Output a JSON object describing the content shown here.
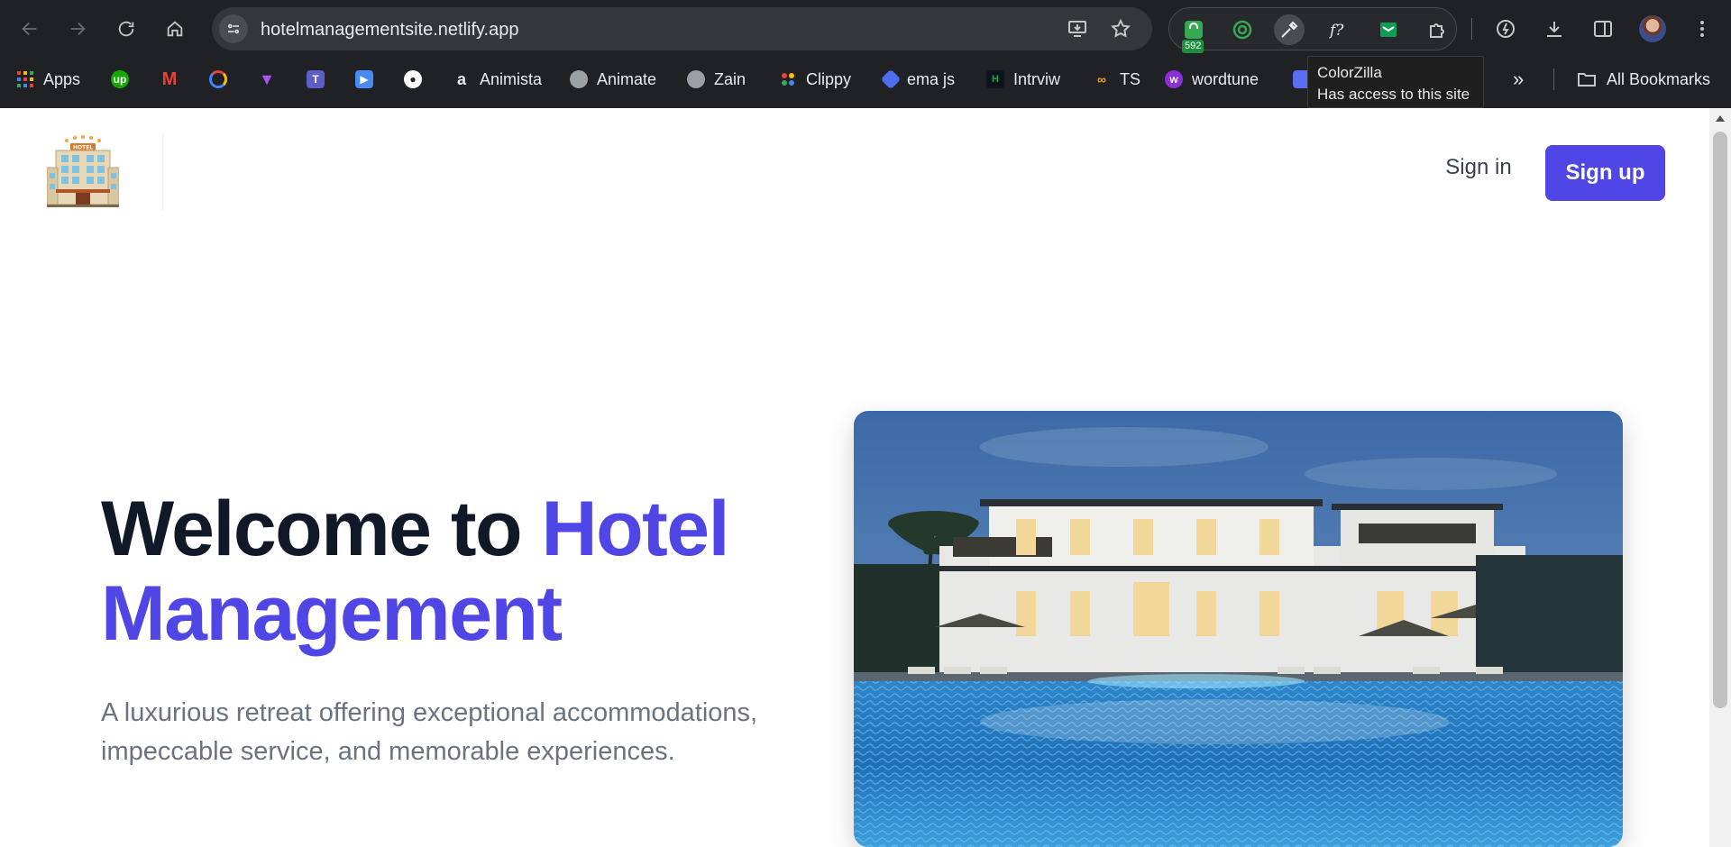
{
  "browser": {
    "url": "hotelmanagementsite.netlify.app",
    "extension_badge": "592",
    "tooltip": {
      "title": "ColorZilla",
      "subtitle": "Has access to this site"
    },
    "bookmarks": [
      {
        "label": "Apps",
        "icon": "apps-grid-icon",
        "color": "#ea4335"
      },
      {
        "label": "",
        "icon": "upwork-icon",
        "color": "#14a800"
      },
      {
        "label": "",
        "icon": "gmail-icon",
        "color": "#ea4335"
      },
      {
        "label": "",
        "icon": "chrome-ring-icon",
        "color": "#4285f4"
      },
      {
        "label": "",
        "icon": "vite-icon",
        "color": "#a855f7"
      },
      {
        "label": "",
        "icon": "teams-icon",
        "color": "#5b5fc7"
      },
      {
        "label": "",
        "icon": "video-icon",
        "color": "#4a8af4"
      },
      {
        "label": "",
        "icon": "github-icon",
        "color": "#ffffff"
      },
      {
        "label": "Animista",
        "icon": "animista-icon",
        "color": "#e8eaed"
      },
      {
        "label": "Animate",
        "icon": "globe-icon",
        "color": "#9aa0a6"
      },
      {
        "label": "Zain",
        "icon": "globe-icon",
        "color": "#9aa0a6"
      },
      {
        "label": "Clippy",
        "icon": "clippy-icon",
        "color": "#f4b400"
      },
      {
        "label": "ema js",
        "icon": "emailjs-icon",
        "color": "#4e6ef2"
      },
      {
        "label": "Intrviw",
        "icon": "hackerrank-icon",
        "color": "#1ba94c"
      },
      {
        "label": "TS",
        "icon": "ts-icon",
        "color": "#f5a623"
      },
      {
        "label": "wordtune",
        "icon": "wordtune-icon",
        "color": "#8b2fd9"
      }
    ],
    "all_bookmarks_label": "All Bookmarks"
  },
  "site": {
    "logo_alt": "HOTEL",
    "nav": {
      "signin_label": "Sign in",
      "signup_label": "Sign up"
    },
    "hero": {
      "title_dark": "Welcome to ",
      "title_accent_1": "Hotel",
      "title_accent_2": "Management",
      "subtitle": "A luxurious retreat offering exceptional accommodations, impeccable service, and memorable experiences."
    }
  },
  "colors": {
    "accent": "#4f46e5",
    "heading": "#111827",
    "body_text": "#6b7280",
    "chrome_bg": "#202124"
  }
}
